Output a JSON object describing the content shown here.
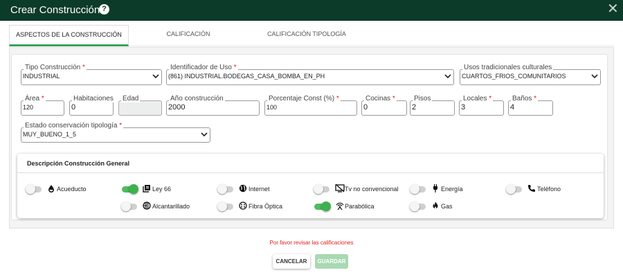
{
  "dialog": {
    "title": "Crear Construcción",
    "help_glyph": "?",
    "close_glyph": "✕"
  },
  "tabs": [
    {
      "label": "ASPECTOS DE LA CONSTRUCCIÓN",
      "active": true
    },
    {
      "label": "CALIFICACIÓN",
      "active": false
    },
    {
      "label": "CALIFICACIÓN TIPOLOGÍA",
      "active": false
    }
  ],
  "fields": {
    "tipo_construccion": {
      "label": "Tipo Construcción",
      "required": "*",
      "value": "INDUSTRIAL"
    },
    "identificador_uso": {
      "label": "Identificador de Uso",
      "required": "*",
      "value": "(861) INDUSTRIAL.BODEGAS_CASA_BOMBA_EN_PH"
    },
    "usos_tradicionales": {
      "label": "Usos tradicionales culturales",
      "value": "CUARTOS_FRIOS_COMUNITARIOS"
    },
    "area": {
      "label": "Área",
      "required": "*",
      "value": "120"
    },
    "habitaciones": {
      "label": "Habitaciones",
      "value": "0"
    },
    "edad": {
      "label": "Edad",
      "value": ""
    },
    "anio_construccion": {
      "label": "Año construcción",
      "value": "2000"
    },
    "porcentaje_const": {
      "label": "Porcentaje Const (%)",
      "required": "*",
      "value": "100"
    },
    "cocinas": {
      "label": "Cocinas",
      "required": "*",
      "value": "0"
    },
    "pisos": {
      "label": "Pisos",
      "value": "2"
    },
    "locales": {
      "label": "Locales",
      "required": "*",
      "value": "3"
    },
    "banos": {
      "label": "Baños",
      "required": "*",
      "value": "4"
    },
    "estado_conservacion": {
      "label": "Estado conservación tipología",
      "required": "*",
      "value": "MUY_BUENO_1_5"
    }
  },
  "services": {
    "title": "Descripción Construcción General",
    "items": [
      {
        "label": "Acueducto",
        "icon": "water-drop-icon",
        "on": false
      },
      {
        "label": "Ley 66",
        "icon": "library-books-icon",
        "on": true
      },
      {
        "label": "Internet",
        "icon": "globe-icon",
        "on": false
      },
      {
        "label": "Tv no convencional",
        "icon": "tv-off-icon",
        "on": false
      },
      {
        "label": "Energía",
        "icon": "power-plug-icon",
        "on": false
      },
      {
        "label": "Teléfono",
        "icon": "phone-icon",
        "on": false
      },
      {
        "label": "Alcantarillado",
        "icon": "sewer-icon",
        "on": false
      },
      {
        "label": "Fibra Óptica",
        "icon": "fiber-icon",
        "on": false
      },
      {
        "label": "Parabólica",
        "icon": "satellite-antenna-icon",
        "on": true
      },
      {
        "label": "Gas",
        "icon": "flame-icon",
        "on": false
      }
    ]
  },
  "footer": {
    "message": "Por favor revisar las calificaciones",
    "cancel_label": "CANCELAR",
    "save_label": "GUARDAR"
  },
  "colors": {
    "header_bg": "#0d3b2a",
    "accent_green": "#3aa35a",
    "toggle_on": "#3fb04f",
    "error_red": "#e0201a",
    "save_disabled": "#a9d9b2"
  }
}
